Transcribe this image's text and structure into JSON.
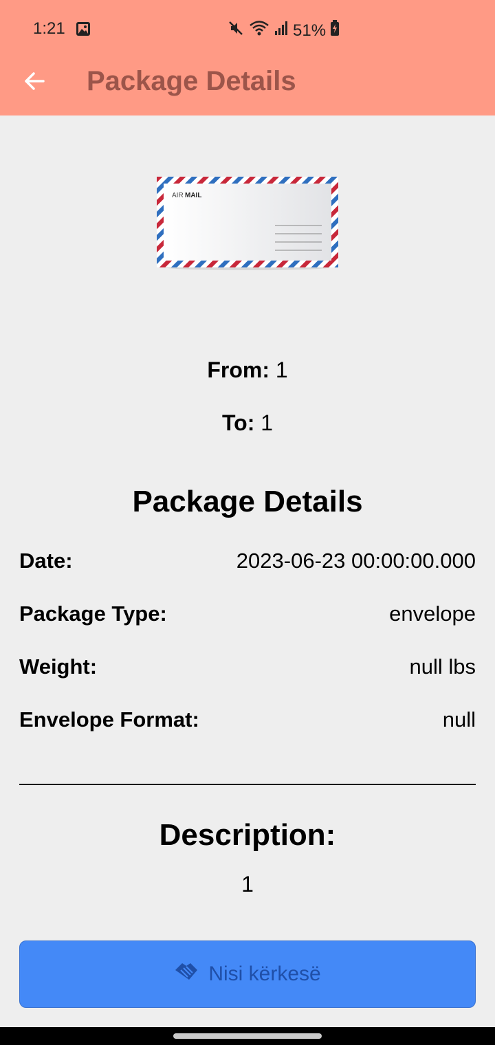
{
  "status_bar": {
    "time": "1:21",
    "battery": "51%"
  },
  "header": {
    "title": "Package Details"
  },
  "envelope_image": {
    "label_air": "AIR",
    "label_mail": "MAIL"
  },
  "addresses": {
    "from_label": "From:",
    "from_value": "1",
    "to_label": "To:",
    "to_value": "1"
  },
  "details": {
    "heading": "Package Details",
    "rows": [
      {
        "label": "Date:",
        "value": "2023-06-23 00:00:00.000"
      },
      {
        "label": "Package Type:",
        "value": "envelope"
      },
      {
        "label": "Weight:",
        "value": "null lbs"
      },
      {
        "label": "Envelope Format:",
        "value": "null"
      }
    ]
  },
  "description": {
    "heading": "Description:",
    "value": "1"
  },
  "action": {
    "label": "Nisi kërkesë"
  },
  "colors": {
    "app_bar": "#ff9a85",
    "title_text": "#9c554a",
    "background": "#eeeeee",
    "button": "#4489f7",
    "button_text": "#1f4fa8"
  }
}
